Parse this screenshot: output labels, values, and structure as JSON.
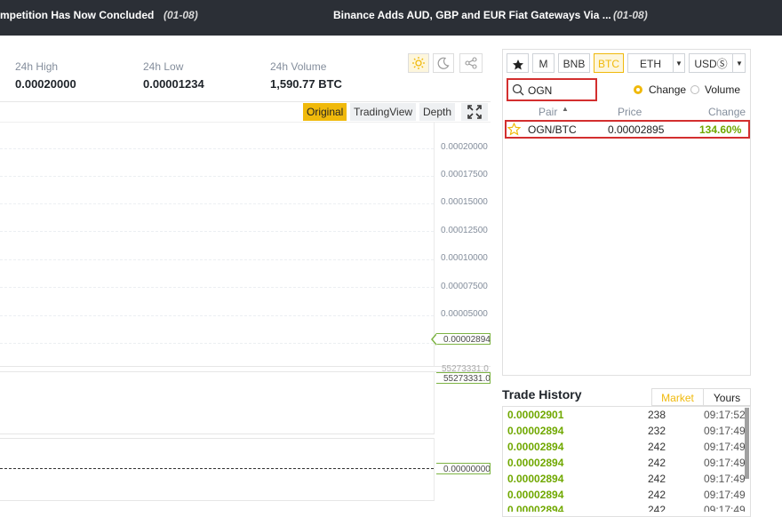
{
  "news": [
    {
      "title": "mpetition Has Now Concluded",
      "date": "(01-08)"
    },
    {
      "title": "Binance Adds AUD, GBP and EUR Fiat Gateways Via ...",
      "date": "(01-08)"
    }
  ],
  "stats": [
    {
      "label": "24h High",
      "value": "0.00020000"
    },
    {
      "label": "24h Low",
      "value": "0.00001234"
    },
    {
      "label": "24h Volume",
      "value": "1,590.77 BTC"
    }
  ],
  "theme": {
    "light_icon": "sun-icon",
    "dark_icon": "moon-icon",
    "share_icon": "share-icon"
  },
  "chart": {
    "tabs": [
      "Original",
      "TradingView",
      "Depth"
    ],
    "active_tab": "Original",
    "y_labels": [
      "0.00020000",
      "0.00017500",
      "0.00015000",
      "0.00012500",
      "0.00010000",
      "0.00007500",
      "0.00005000"
    ],
    "last_price_tag": "0.00002894",
    "volume_label_faint": "55273331.0",
    "volume_tag": "55273331.0",
    "indicator_tag": "0.00000000"
  },
  "market": {
    "buttons": {
      "favorites_icon": "star-icon",
      "margin": "M",
      "bnb": "BNB",
      "btc": "BTC",
      "eth": "ETH",
      "usd": "USDⓈ"
    },
    "active_market": "BTC",
    "search": {
      "value": "OGN",
      "icon": "search-icon"
    },
    "radio": [
      {
        "label": "Change",
        "checked": true
      },
      {
        "label": "Volume",
        "checked": false
      }
    ],
    "columns": {
      "pair": "Pair",
      "price": "Price",
      "change": "Change"
    },
    "rows": [
      {
        "pair": "OGN/BTC",
        "price": "0.00002895",
        "change": "134.60%"
      }
    ]
  },
  "trade_history": {
    "title": "Trade History",
    "tabs": [
      "Market",
      "Yours"
    ],
    "active_tab": "Market",
    "rows": [
      {
        "price": "0.00002901",
        "amount": "238",
        "time": "09:17:52"
      },
      {
        "price": "0.00002894",
        "amount": "232",
        "time": "09:17:49"
      },
      {
        "price": "0.00002894",
        "amount": "242",
        "time": "09:17:49"
      },
      {
        "price": "0.00002894",
        "amount": "242",
        "time": "09:17:49"
      },
      {
        "price": "0.00002894",
        "amount": "242",
        "time": "09:17:49"
      },
      {
        "price": "0.00002894",
        "amount": "242",
        "time": "09:17:49"
      },
      {
        "price": "0.00002894",
        "amount": "242",
        "time": "09:17:49"
      }
    ]
  },
  "colors": {
    "accent": "#f0b90b",
    "positive": "#70a800",
    "highlight_border": "#d32f2f",
    "topbar": "#2b2f36"
  }
}
